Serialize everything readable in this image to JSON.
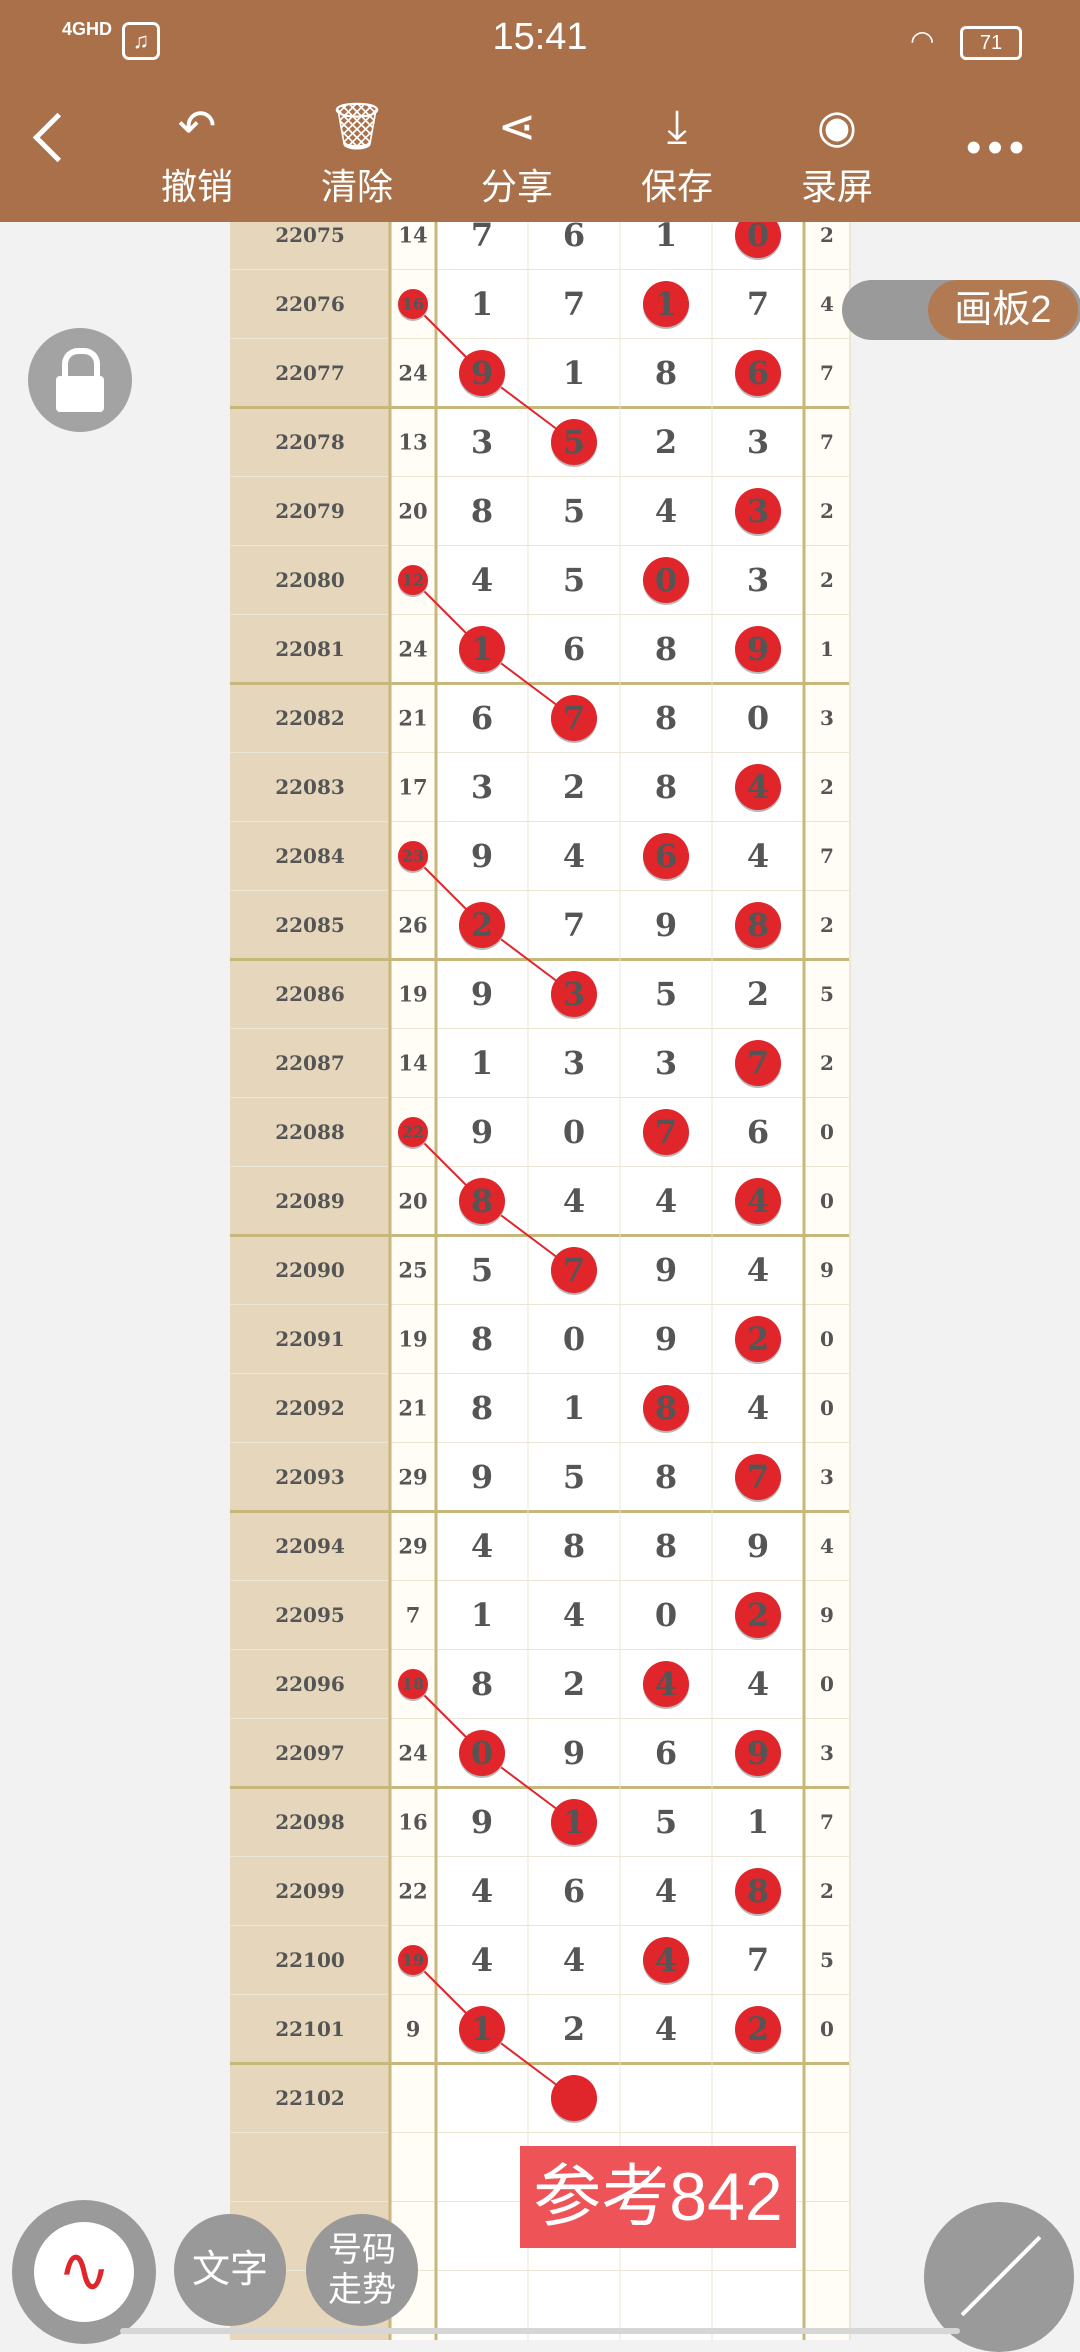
{
  "status": {
    "time": "15:41",
    "network": "4GHD",
    "battery": "71"
  },
  "toolbar": {
    "undo_label": "撤销",
    "clear_label": "清除",
    "share_label": "分享",
    "save_label": "保存",
    "record_label": "录屏"
  },
  "board_label": "画板2",
  "reference_text": "参考842",
  "bottom": {
    "text_label": "文字",
    "trend_line1": "号码",
    "trend_line2": "走势"
  },
  "colors": {
    "header": "#a9704a",
    "circle": "#e0262b",
    "grid_line": "#c8b77a",
    "side_panel": "#e6d6bc"
  },
  "rows": [
    {
      "period": "22075",
      "sum": "14",
      "digits": [
        "7",
        "6",
        "1",
        "0"
      ],
      "last": "2",
      "marks": [
        3
      ]
    },
    {
      "period": "22076",
      "sum": "16",
      "digits": [
        "1",
        "7",
        "1",
        "7"
      ],
      "last": "4",
      "marks": [
        2
      ],
      "sum_mark": true
    },
    {
      "period": "22077",
      "sum": "24",
      "digits": [
        "9",
        "1",
        "8",
        "6"
      ],
      "last": "7",
      "marks": [
        0,
        3
      ]
    },
    {
      "period": "22078",
      "sum": "13",
      "digits": [
        "3",
        "5",
        "2",
        "3"
      ],
      "last": "7",
      "marks": [
        1
      ]
    },
    {
      "period": "22079",
      "sum": "20",
      "digits": [
        "8",
        "5",
        "4",
        "3"
      ],
      "last": "2",
      "marks": [
        3
      ]
    },
    {
      "period": "22080",
      "sum": "12",
      "digits": [
        "4",
        "5",
        "0",
        "3"
      ],
      "last": "2",
      "marks": [
        2
      ],
      "sum_mark": true
    },
    {
      "period": "22081",
      "sum": "24",
      "digits": [
        "1",
        "6",
        "8",
        "9"
      ],
      "last": "1",
      "marks": [
        0,
        3
      ]
    },
    {
      "period": "22082",
      "sum": "21",
      "digits": [
        "6",
        "7",
        "8",
        "0"
      ],
      "last": "3",
      "marks": [
        1
      ]
    },
    {
      "period": "22083",
      "sum": "17",
      "digits": [
        "3",
        "2",
        "8",
        "4"
      ],
      "last": "2",
      "marks": [
        3
      ]
    },
    {
      "period": "22084",
      "sum": "23",
      "digits": [
        "9",
        "4",
        "6",
        "4"
      ],
      "last": "7",
      "marks": [
        2
      ],
      "sum_mark": true
    },
    {
      "period": "22085",
      "sum": "26",
      "digits": [
        "2",
        "7",
        "9",
        "8"
      ],
      "last": "2",
      "marks": [
        0,
        3
      ]
    },
    {
      "period": "22086",
      "sum": "19",
      "digits": [
        "9",
        "3",
        "5",
        "2"
      ],
      "last": "5",
      "marks": [
        1
      ]
    },
    {
      "period": "22087",
      "sum": "14",
      "digits": [
        "1",
        "3",
        "3",
        "7"
      ],
      "last": "2",
      "marks": [
        3
      ]
    },
    {
      "period": "22088",
      "sum": "22",
      "digits": [
        "9",
        "0",
        "7",
        "6"
      ],
      "last": "0",
      "marks": [
        2
      ],
      "sum_mark": true
    },
    {
      "period": "22089",
      "sum": "20",
      "digits": [
        "8",
        "4",
        "4",
        "4"
      ],
      "last": "0",
      "marks": [
        0,
        3
      ]
    },
    {
      "period": "22090",
      "sum": "25",
      "digits": [
        "5",
        "7",
        "9",
        "4"
      ],
      "last": "9",
      "marks": [
        1
      ]
    },
    {
      "period": "22091",
      "sum": "19",
      "digits": [
        "8",
        "0",
        "9",
        "2"
      ],
      "last": "0",
      "marks": [
        3
      ]
    },
    {
      "period": "22092",
      "sum": "21",
      "digits": [
        "8",
        "1",
        "8",
        "4"
      ],
      "last": "0",
      "marks": [
        2
      ]
    },
    {
      "period": "22093",
      "sum": "29",
      "digits": [
        "9",
        "5",
        "8",
        "7"
      ],
      "last": "3",
      "marks": [
        3
      ]
    },
    {
      "period": "22094",
      "sum": "29",
      "digits": [
        "4",
        "8",
        "8",
        "9"
      ],
      "last": "4",
      "marks": []
    },
    {
      "period": "22095",
      "sum": "7",
      "digits": [
        "1",
        "4",
        "0",
        "2"
      ],
      "last": "9",
      "marks": [
        3
      ]
    },
    {
      "period": "22096",
      "sum": "18",
      "digits": [
        "8",
        "2",
        "4",
        "4"
      ],
      "last": "0",
      "marks": [
        2
      ],
      "sum_mark": true
    },
    {
      "period": "22097",
      "sum": "24",
      "digits": [
        "0",
        "9",
        "6",
        "9"
      ],
      "last": "3",
      "marks": [
        0,
        3
      ]
    },
    {
      "period": "22098",
      "sum": "16",
      "digits": [
        "9",
        "1",
        "5",
        "1"
      ],
      "last": "7",
      "marks": [
        1
      ]
    },
    {
      "period": "22099",
      "sum": "22",
      "digits": [
        "4",
        "6",
        "4",
        "8"
      ],
      "last": "2",
      "marks": [
        3
      ]
    },
    {
      "period": "22100",
      "sum": "19",
      "digits": [
        "4",
        "4",
        "4",
        "7"
      ],
      "last": "5",
      "marks": [
        2
      ],
      "sum_mark": true
    },
    {
      "period": "22101",
      "sum": "9",
      "digits": [
        "1",
        "2",
        "4",
        "2"
      ],
      "last": "0",
      "marks": [
        0,
        3
      ]
    },
    {
      "period": "22102",
      "sum": "",
      "digits": [
        "",
        "",
        "",
        ""
      ],
      "last": "",
      "marks": [],
      "dot_col": 1
    }
  ]
}
